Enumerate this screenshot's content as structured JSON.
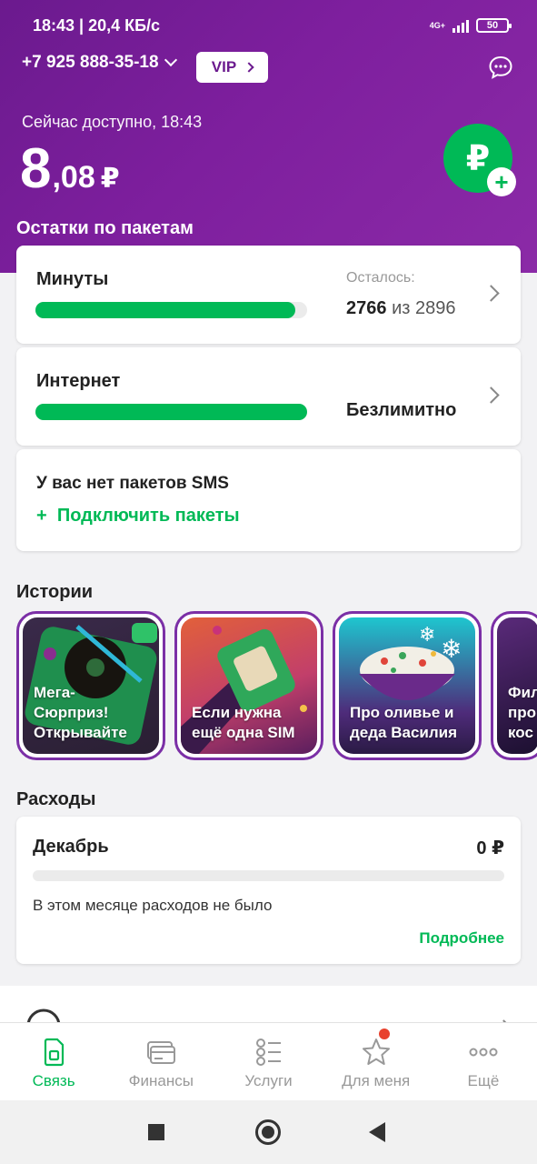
{
  "status_bar": {
    "time_speed": "18:43 | 20,4 КБ/с",
    "network": "4G+",
    "battery": "50"
  },
  "header": {
    "phone": "+7 925 888-35-18",
    "vip_label": "VIP",
    "available_label": "Сейчас доступно, 18:43",
    "balance_int": "8",
    "balance_frac": ",08",
    "currency": "₽",
    "topup_symbol": "₽",
    "topup_plus": "+"
  },
  "packages": {
    "title": "Остатки по пакетам",
    "minutes": {
      "label": "Минуты",
      "left_label": "Осталось:",
      "remaining": "2766",
      "of_text": "из 2896",
      "fraction": 0.955
    },
    "internet": {
      "label": "Интернет",
      "value": "Безлимитно",
      "fraction": 1.0
    },
    "sms": {
      "label": "У вас нет пакетов SMS",
      "action": "Подключить пакеты",
      "action_plus": "+"
    }
  },
  "stories": {
    "title": "Истории",
    "items": [
      {
        "text": "Мега-\nСюрприз!\nОткрывайте"
      },
      {
        "text": "Если нужна\nещё одна SIM"
      },
      {
        "text": "Про оливье и\nдеда Василия"
      },
      {
        "text": "Фил\nпро\nкос"
      }
    ]
  },
  "expenses": {
    "title": "Расходы",
    "month": "Декабрь",
    "amount": "0 ₽",
    "note": "В этом месяце расходов не было",
    "more": "Подробнее"
  },
  "tabs": [
    {
      "label": "Связь",
      "icon": "sim-icon",
      "active": true
    },
    {
      "label": "Финансы",
      "icon": "cards-icon",
      "active": false
    },
    {
      "label": "Услуги",
      "icon": "list-icon",
      "active": false
    },
    {
      "label": "Для меня",
      "icon": "star-icon",
      "active": false,
      "badge": true
    },
    {
      "label": "Ещё",
      "icon": "more-icon",
      "active": false
    }
  ],
  "colors": {
    "brand_purple": "#7e1f9e",
    "accent_green": "#00b956",
    "badge_red": "#e8412d"
  }
}
